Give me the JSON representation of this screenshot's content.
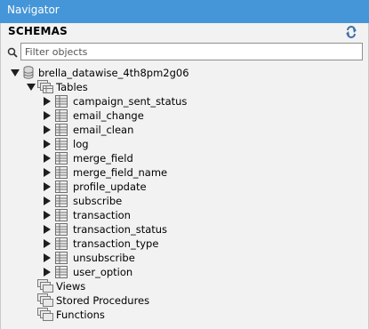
{
  "navigator": {
    "title": "Navigator"
  },
  "schemas": {
    "header": "SCHEMAS",
    "filter_placeholder": "Filter objects",
    "filter_value": ""
  },
  "tree": {
    "schema": {
      "name": "brella_datawise_4th8pm2g06",
      "expanded": true
    },
    "tables_label": "Tables",
    "tables": [
      "campaign_sent_status",
      "email_change",
      "email_clean",
      "log",
      "merge_field",
      "merge_field_name",
      "profile_update",
      "subscribe",
      "transaction",
      "transaction_status",
      "transaction_type",
      "unsubscribe",
      "user_option"
    ],
    "views_label": "Views",
    "procedures_label": "Stored Procedures",
    "functions_label": "Functions"
  },
  "colors": {
    "titlebar": "#4596d8",
    "panel_bg": "#f2f2f2",
    "input_border": "#8f8f8f"
  },
  "icons": [
    "refresh-icon",
    "search-icon",
    "database-icon",
    "folder-tables-icon",
    "table-icon",
    "chevron-right-icon",
    "chevron-down-icon"
  ]
}
